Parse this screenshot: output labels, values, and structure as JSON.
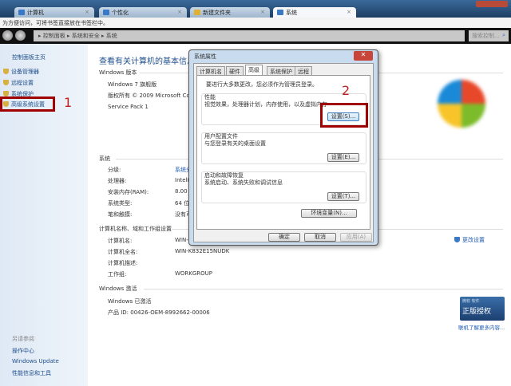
{
  "tabs": [
    {
      "label": "计算机"
    },
    {
      "label": "个性化"
    },
    {
      "label": "新建文件夹"
    },
    {
      "label": "系统"
    }
  ],
  "bookmark_bar": "为方便访问，可将书签直接放在书签栏中。",
  "breadcrumb": [
    "控制面板",
    "系统和安全",
    "系统"
  ],
  "search_placeholder": "搜索控制...",
  "sidebar": {
    "home": "控制面板主页",
    "items": [
      {
        "label": "设备管理器"
      },
      {
        "label": "远程设置"
      },
      {
        "label": "系统保护"
      },
      {
        "label": "高级系统设置"
      }
    ],
    "see_also": "另请参阅",
    "links": [
      "操作中心",
      "Windows Update",
      "性能信息和工具"
    ]
  },
  "annotations": {
    "one": "1",
    "two": "2"
  },
  "main": {
    "title": "查看有关计算机的基本信息",
    "edition_header": "Windows 版本",
    "edition": "Windows 7 旗舰版",
    "copyright": "版权所有 © 2009 Microsoft Cor",
    "sp": "Service Pack 1",
    "system_header": "系统",
    "system_rows": [
      {
        "label": "分级:",
        "value": "系统分"
      },
      {
        "label": "处理器:",
        "value": "Intel("
      },
      {
        "label": "安装内存(RAM):",
        "value": "8.00 ("
      },
      {
        "label": "系统类型:",
        "value": "64 位"
      },
      {
        "label": "笔和触摸:",
        "value": "没有可"
      }
    ],
    "name_header": "计算机名称、域和工作组设置",
    "name_rows": [
      {
        "label": "计算机名:",
        "value": "WIN-"
      },
      {
        "label": "计算机全名:",
        "value": "WIN-K832E15NUDK"
      },
      {
        "label": "计算机描述:",
        "value": ""
      },
      {
        "label": "工作组:",
        "value": "WORKGROUP"
      }
    ],
    "change_settings": "更改设置",
    "activation_header": "Windows 激活",
    "activated": "Windows 已激活",
    "product_id": "产品 ID: 00426-OEM-8992662-00006",
    "genuine_badge": "正版授权",
    "genuine_sub": "微软 软件",
    "learn_more": "联机了解更多内容..."
  },
  "dialog": {
    "title": "系统属性",
    "tabs": [
      "计算机名",
      "硬件",
      "高级",
      "系统保护",
      "远程"
    ],
    "admin_note": "要进行大多数更改，您必须作为管理员登录。",
    "perf_title": "性能",
    "perf_desc": "视觉效果，处理器计划，内存使用，以及虚拟内存",
    "perf_btn": "设置(S)...",
    "profile_title": "用户配置文件",
    "profile_desc": "与您登录有关的桌面设置",
    "profile_btn": "设置(E)...",
    "startup_title": "启动和故障恢复",
    "startup_desc": "系统启动、系统失败和调试信息",
    "startup_btn": "设置(T)...",
    "env_btn": "环境变量(N)...",
    "ok": "确定",
    "cancel": "取消",
    "apply": "应用(A)"
  }
}
